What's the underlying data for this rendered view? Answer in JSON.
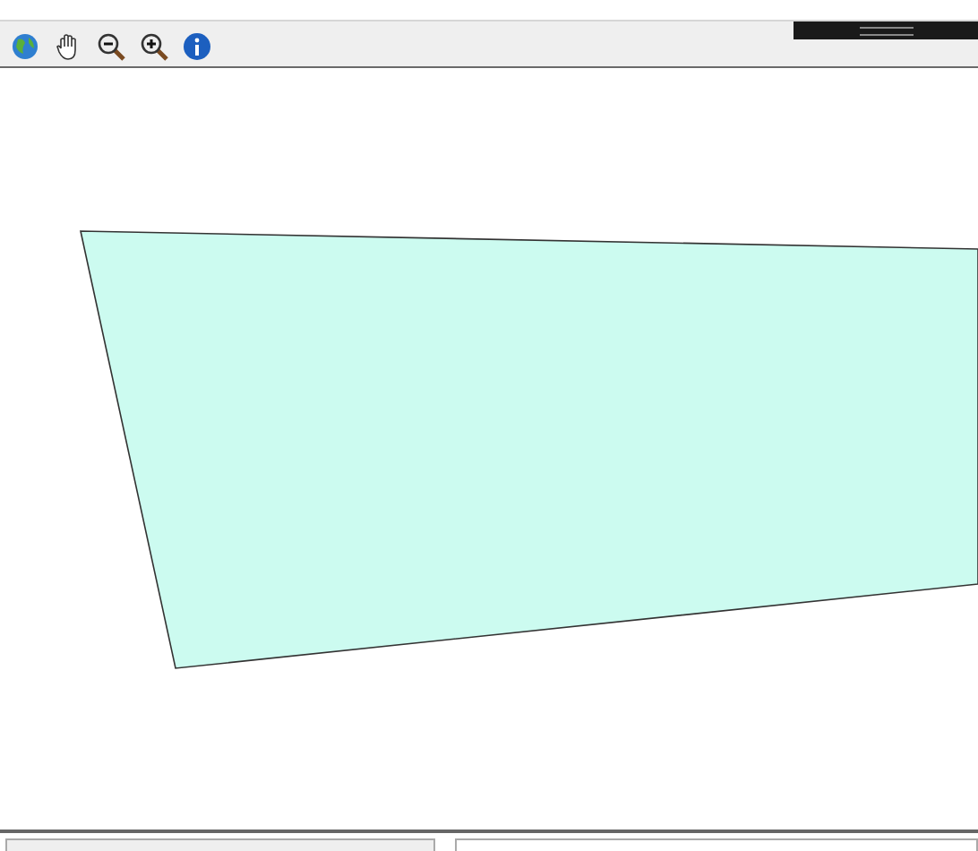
{
  "toolbar": {
    "tools": [
      {
        "kind": "globe"
      },
      {
        "kind": "pan"
      },
      {
        "kind": "zoom_out"
      },
      {
        "kind": "zoom_in"
      },
      {
        "kind": "info"
      }
    ]
  },
  "map": {
    "polygons": [
      {
        "color": "#ccfbf0"
      }
    ]
  }
}
